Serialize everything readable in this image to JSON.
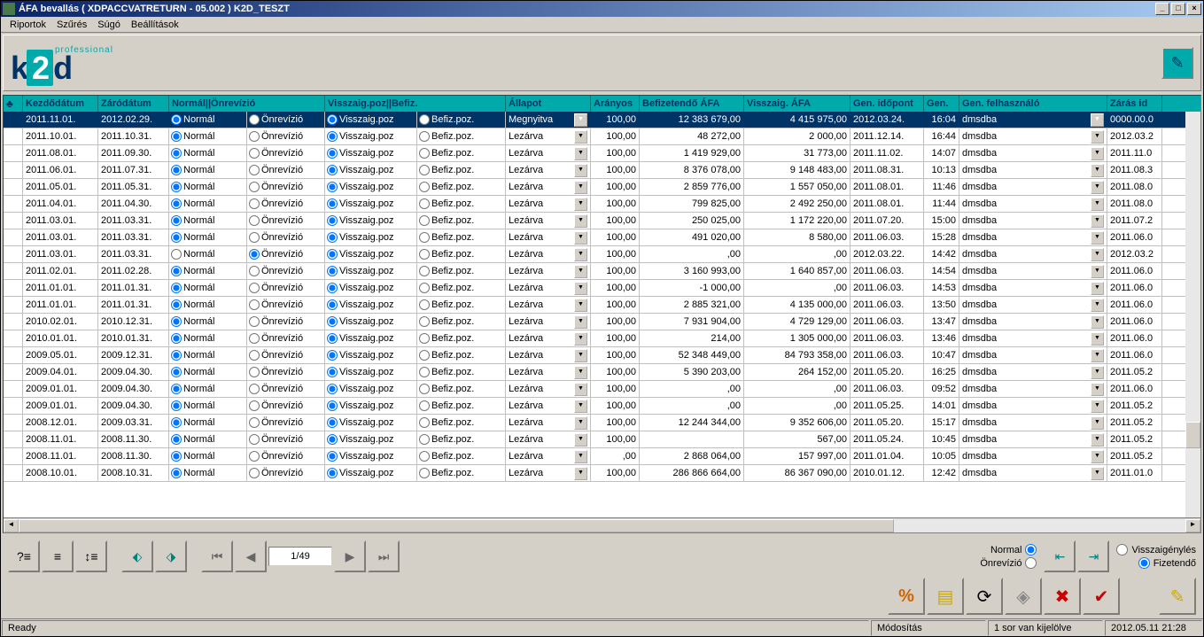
{
  "window": {
    "title": "ÁFA bevallás ( XDPACCVATRETURN - 05.002 )      K2D_TESZT"
  },
  "menu": [
    "Riportok",
    "Szűrés",
    "Súgó",
    "Beállítások"
  ],
  "logo": {
    "professional": "professional",
    "brand": "k2d"
  },
  "grid": {
    "headers": {
      "icon": "♣",
      "kezdo": "Kezdődátum",
      "zaro": "Záródátum",
      "normalonrev": "Normál||Önrevízió",
      "visszaigbefiz": "Visszaig.poz||Befiz.",
      "allapot": "Állapot",
      "aranyos": "Arányos",
      "befafa": "Befizetendő ÁFA",
      "visszaigafa": "Visszaig. ÁFA",
      "gendate": "Gen. időpont",
      "gentime": "Gen.",
      "genuser": "Gen. felhasználó",
      "zarasid": "Zárás id"
    },
    "radioLabels": {
      "normal": "Normál",
      "onrev": "Önrevízió",
      "visszaig": "Visszaig.poz",
      "befiz": "Befiz.poz."
    },
    "rows": [
      {
        "kezdo": "2011.11.01.",
        "zaro": "2012.02.29.",
        "normal": true,
        "onrev": false,
        "visszaig": true,
        "befiz": false,
        "allapot": "Megnyitva",
        "aranyos": "100,00",
        "befafa": "12 383 679,00",
        "visszaigafa": "4 415 975,00",
        "gendate": "2012.03.24.",
        "gentime": "16:04",
        "genuser": "dmsdba",
        "zarasid": "0000.00.0",
        "selected": true
      },
      {
        "kezdo": "2011.10.01.",
        "zaro": "2011.10.31.",
        "normal": true,
        "onrev": false,
        "visszaig": true,
        "befiz": false,
        "allapot": "Lezárva",
        "aranyos": "100,00",
        "befafa": "48 272,00",
        "visszaigafa": "2 000,00",
        "gendate": "2011.12.14.",
        "gentime": "16:44",
        "genuser": "dmsdba",
        "zarasid": "2012.03.2"
      },
      {
        "kezdo": "2011.08.01.",
        "zaro": "2011.09.30.",
        "normal": true,
        "onrev": false,
        "visszaig": true,
        "befiz": false,
        "allapot": "Lezárva",
        "aranyos": "100,00",
        "befafa": "1 419 929,00",
        "visszaigafa": "31 773,00",
        "gendate": "2011.11.02.",
        "gentime": "14:07",
        "genuser": "dmsdba",
        "zarasid": "2011.11.0"
      },
      {
        "kezdo": "2011.06.01.",
        "zaro": "2011.07.31.",
        "normal": true,
        "onrev": false,
        "visszaig": true,
        "befiz": false,
        "allapot": "Lezárva",
        "aranyos": "100,00",
        "befafa": "8 376 078,00",
        "visszaigafa": "9 148 483,00",
        "gendate": "2011.08.31.",
        "gentime": "10:13",
        "genuser": "dmsdba",
        "zarasid": "2011.08.3"
      },
      {
        "kezdo": "2011.05.01.",
        "zaro": "2011.05.31.",
        "normal": true,
        "onrev": false,
        "visszaig": true,
        "befiz": false,
        "allapot": "Lezárva",
        "aranyos": "100,00",
        "befafa": "2 859 776,00",
        "visszaigafa": "1 557 050,00",
        "gendate": "2011.08.01.",
        "gentime": "11:46",
        "genuser": "dmsdba",
        "zarasid": "2011.08.0"
      },
      {
        "kezdo": "2011.04.01.",
        "zaro": "2011.04.30.",
        "normal": true,
        "onrev": false,
        "visszaig": true,
        "befiz": false,
        "allapot": "Lezárva",
        "aranyos": "100,00",
        "befafa": "799 825,00",
        "visszaigafa": "2 492 250,00",
        "gendate": "2011.08.01.",
        "gentime": "11:44",
        "genuser": "dmsdba",
        "zarasid": "2011.08.0"
      },
      {
        "kezdo": "2011.03.01.",
        "zaro": "2011.03.31.",
        "normal": true,
        "onrev": false,
        "visszaig": true,
        "befiz": false,
        "allapot": "Lezárva",
        "aranyos": "100,00",
        "befafa": "250 025,00",
        "visszaigafa": "1 172 220,00",
        "gendate": "2011.07.20.",
        "gentime": "15:00",
        "genuser": "dmsdba",
        "zarasid": "2011.07.2"
      },
      {
        "kezdo": "2011.03.01.",
        "zaro": "2011.03.31.",
        "normal": true,
        "onrev": false,
        "visszaig": true,
        "befiz": false,
        "allapot": "Lezárva",
        "aranyos": "100,00",
        "befafa": "491 020,00",
        "visszaigafa": "8 580,00",
        "gendate": "2011.06.03.",
        "gentime": "15:28",
        "genuser": "dmsdba",
        "zarasid": "2011.06.0"
      },
      {
        "kezdo": "2011.03.01.",
        "zaro": "2011.03.31.",
        "normal": false,
        "onrev": true,
        "visszaig": true,
        "befiz": false,
        "allapot": "Lezárva",
        "aranyos": "100,00",
        "befafa": ",00",
        "visszaigafa": ",00",
        "gendate": "2012.03.22.",
        "gentime": "14:42",
        "genuser": "dmsdba",
        "zarasid": "2012.03.2"
      },
      {
        "kezdo": "2011.02.01.",
        "zaro": "2011.02.28.",
        "normal": true,
        "onrev": false,
        "visszaig": true,
        "befiz": false,
        "allapot": "Lezárva",
        "aranyos": "100,00",
        "befafa": "3 160 993,00",
        "visszaigafa": "1 640 857,00",
        "gendate": "2011.06.03.",
        "gentime": "14:54",
        "genuser": "dmsdba",
        "zarasid": "2011.06.0"
      },
      {
        "kezdo": "2011.01.01.",
        "zaro": "2011.01.31.",
        "normal": true,
        "onrev": false,
        "visszaig": true,
        "befiz": false,
        "allapot": "Lezárva",
        "aranyos": "100,00",
        "befafa": "-1 000,00",
        "visszaigafa": ",00",
        "gendate": "2011.06.03.",
        "gentime": "14:53",
        "genuser": "dmsdba",
        "zarasid": "2011.06.0"
      },
      {
        "kezdo": "2011.01.01.",
        "zaro": "2011.01.31.",
        "normal": true,
        "onrev": false,
        "visszaig": true,
        "befiz": false,
        "allapot": "Lezárva",
        "aranyos": "100,00",
        "befafa": "2 885 321,00",
        "visszaigafa": "4 135 000,00",
        "gendate": "2011.06.03.",
        "gentime": "13:50",
        "genuser": "dmsdba",
        "zarasid": "2011.06.0"
      },
      {
        "kezdo": "2010.02.01.",
        "zaro": "2010.12.31.",
        "normal": true,
        "onrev": false,
        "visszaig": true,
        "befiz": false,
        "allapot": "Lezárva",
        "aranyos": "100,00",
        "befafa": "7 931 904,00",
        "visszaigafa": "4 729 129,00",
        "gendate": "2011.06.03.",
        "gentime": "13:47",
        "genuser": "dmsdba",
        "zarasid": "2011.06.0"
      },
      {
        "kezdo": "2010.01.01.",
        "zaro": "2010.01.31.",
        "normal": true,
        "onrev": false,
        "visszaig": true,
        "befiz": false,
        "allapot": "Lezárva",
        "aranyos": "100,00",
        "befafa": "214,00",
        "visszaigafa": "1 305 000,00",
        "gendate": "2011.06.03.",
        "gentime": "13:46",
        "genuser": "dmsdba",
        "zarasid": "2011.06.0"
      },
      {
        "kezdo": "2009.05.01.",
        "zaro": "2009.12.31.",
        "normal": true,
        "onrev": false,
        "visszaig": true,
        "befiz": false,
        "allapot": "Lezárva",
        "aranyos": "100,00",
        "befafa": "52 348 449,00",
        "visszaigafa": "84 793 358,00",
        "gendate": "2011.06.03.",
        "gentime": "10:47",
        "genuser": "dmsdba",
        "zarasid": "2011.06.0"
      },
      {
        "kezdo": "2009.04.01.",
        "zaro": "2009.04.30.",
        "normal": true,
        "onrev": false,
        "visszaig": true,
        "befiz": false,
        "allapot": "Lezárva",
        "aranyos": "100,00",
        "befafa": "5 390 203,00",
        "visszaigafa": "264 152,00",
        "gendate": "2011.05.20.",
        "gentime": "16:25",
        "genuser": "dmsdba",
        "zarasid": "2011.05.2"
      },
      {
        "kezdo": "2009.01.01.",
        "zaro": "2009.04.30.",
        "normal": true,
        "onrev": false,
        "visszaig": true,
        "befiz": false,
        "allapot": "Lezárva",
        "aranyos": "100,00",
        "befafa": ",00",
        "visszaigafa": ",00",
        "gendate": "2011.06.03.",
        "gentime": "09:52",
        "genuser": "dmsdba",
        "zarasid": "2011.06.0"
      },
      {
        "kezdo": "2009.01.01.",
        "zaro": "2009.04.30.",
        "normal": true,
        "onrev": false,
        "visszaig": true,
        "befiz": false,
        "allapot": "Lezárva",
        "aranyos": "100,00",
        "befafa": ",00",
        "visszaigafa": ",00",
        "gendate": "2011.05.25.",
        "gentime": "14:01",
        "genuser": "dmsdba",
        "zarasid": "2011.05.2"
      },
      {
        "kezdo": "2008.12.01.",
        "zaro": "2009.03.31.",
        "normal": true,
        "onrev": false,
        "visszaig": true,
        "befiz": false,
        "allapot": "Lezárva",
        "aranyos": "100,00",
        "befafa": "12 244 344,00",
        "visszaigafa": "9 352 606,00",
        "gendate": "2011.05.20.",
        "gentime": "15:17",
        "genuser": "dmsdba",
        "zarasid": "2011.05.2"
      },
      {
        "kezdo": "2008.11.01.",
        "zaro": "2008.11.30.",
        "normal": true,
        "onrev": false,
        "visszaig": true,
        "befiz": false,
        "allapot": "Lezárva",
        "aranyos": "100,00",
        "befafa": "",
        "visszaigafa": "567,00",
        "gendate": "2011.05.24.",
        "gentime": "10:45",
        "genuser": "dmsdba",
        "zarasid": "2011.05.2"
      },
      {
        "kezdo": "2008.11.01.",
        "zaro": "2008.11.30.",
        "normal": true,
        "onrev": false,
        "visszaig": true,
        "befiz": false,
        "allapot": "Lezárva",
        "aranyos": ",00",
        "befafa": "2 868 064,00",
        "visszaigafa": "157 997,00",
        "gendate": "2011.01.04.",
        "gentime": "10:05",
        "genuser": "dmsdba",
        "zarasid": "2011.05.2"
      },
      {
        "kezdo": "2008.10.01.",
        "zaro": "2008.10.31.",
        "normal": true,
        "onrev": false,
        "visszaig": true,
        "befiz": false,
        "allapot": "Lezárva",
        "aranyos": "100,00",
        "befafa": "286 866 664,00",
        "visszaigafa": "86 367 090,00",
        "gendate": "2010.01.12.",
        "gentime": "12:42",
        "genuser": "dmsdba",
        "zarasid": "2011.01.0"
      }
    ]
  },
  "toolbar": {
    "page": "1/49",
    "normal": "Normal",
    "onrevizio": "Önrevízió",
    "visszaigenyes": "Visszaigénylés",
    "fizetendo": "Fizetendő"
  },
  "status": {
    "ready": "Ready",
    "modositas": "Módosítás",
    "selection": "1 sor van kijelölve",
    "datetime": "2012.05.11 21:28"
  }
}
